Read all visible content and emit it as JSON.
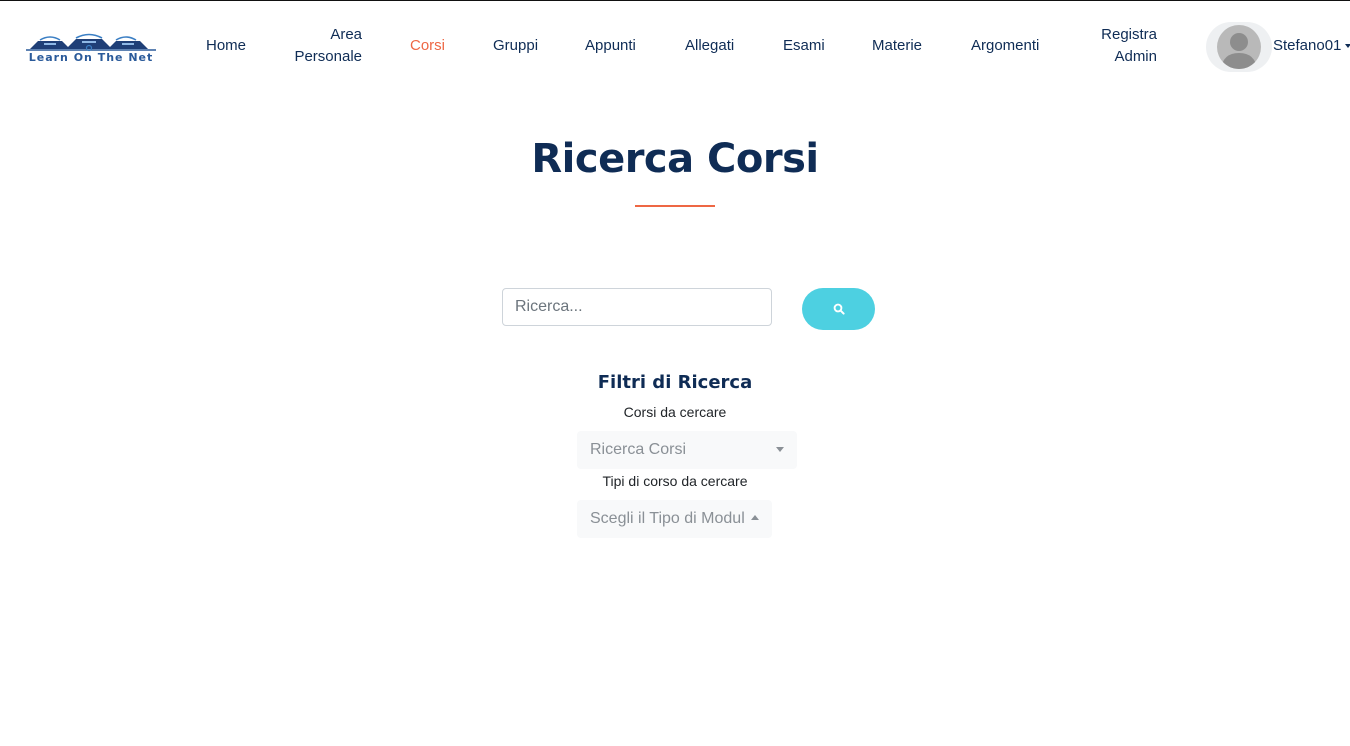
{
  "brand": {
    "logo_text": "Learn On The Net",
    "colors": {
      "navy": "#0f2c55",
      "accent": "#ee6744",
      "search_button": "#4dd0e1"
    }
  },
  "nav": {
    "home": "Home",
    "area_personale_line1": "Area",
    "area_personale_line2": "Personale",
    "corsi": "Corsi",
    "gruppi": "Gruppi",
    "appunti": "Appunti",
    "allegati": "Allegati",
    "esami": "Esami",
    "materie": "Materie",
    "argomenti": "Argomenti",
    "registra_admin_line1": "Registra",
    "registra_admin_line2": "Admin",
    "active": "Corsi"
  },
  "user": {
    "name": "Stefano01",
    "avatar_icon": "user-silhouette-icon",
    "menu_icon": "chevron-down-icon"
  },
  "page": {
    "title": "Ricerca Corsi"
  },
  "search": {
    "placeholder": "Ricerca...",
    "value": "",
    "button_icon": "search-icon"
  },
  "filters": {
    "title": "Filtri di Ricerca",
    "courses_label": "Corsi da cercare",
    "courses_select_value": "Ricerca Corsi",
    "types_label": "Tipi di corso da cercare",
    "types_select_value": "Scegli il Tipo di Modul"
  }
}
